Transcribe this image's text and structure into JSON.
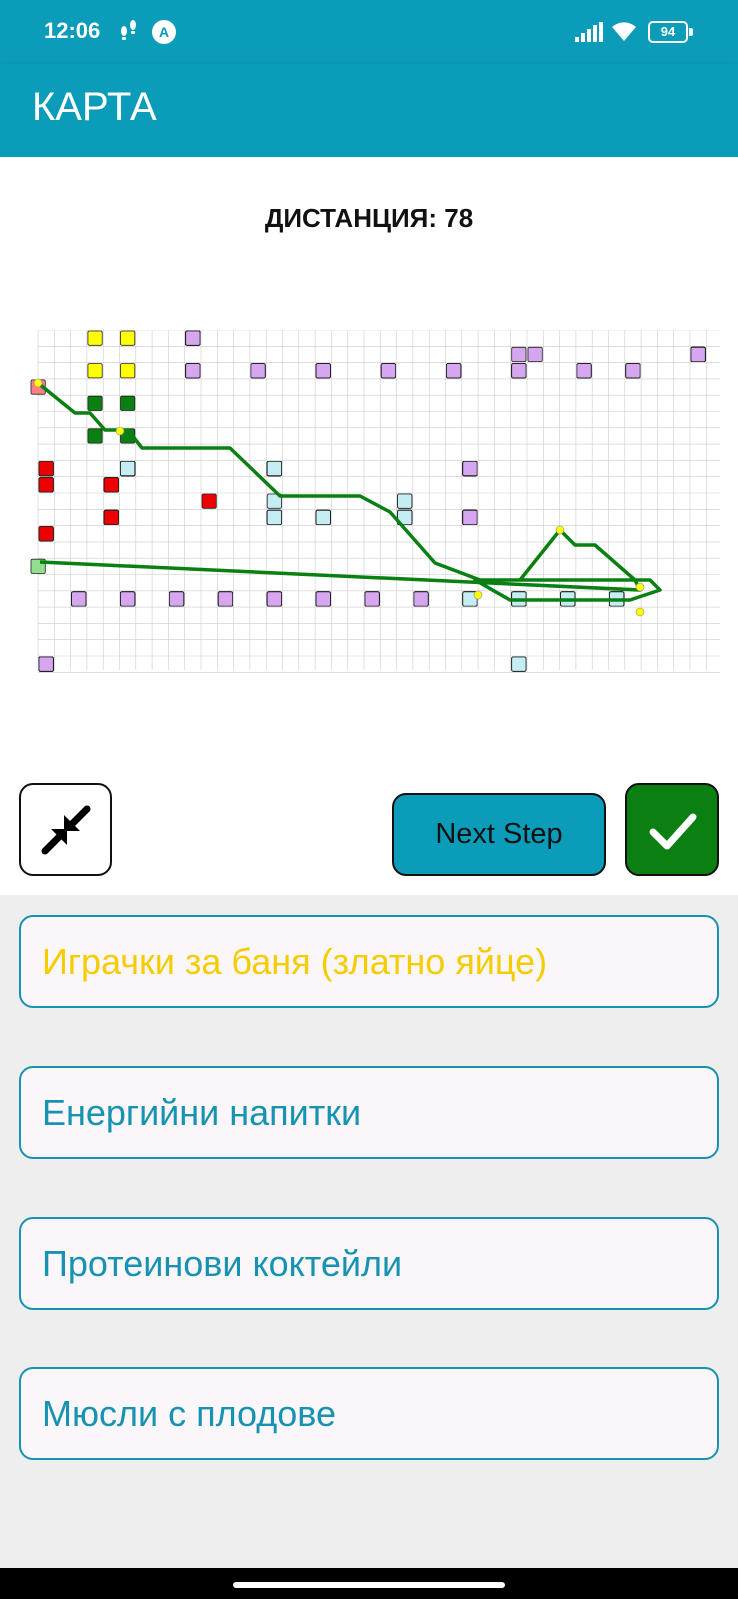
{
  "status": {
    "time": "12:06",
    "steps_icon": "footsteps-icon",
    "app_icon_letter": "A",
    "battery": "94",
    "icons": [
      "signal-icon",
      "wifi-icon",
      "battery-icon"
    ]
  },
  "appbar": {
    "title": "КАРТА"
  },
  "distance": {
    "text": "ДИСТАНЦИЯ: 78"
  },
  "map": {
    "legend_colors": {
      "shelf": "#d6a6f0",
      "visited_shelf": "#c4eef4",
      "red_shelf": "#ee0000",
      "yellow_marker": "#ffff00",
      "green_marker": "#0a7f12",
      "route": "#0a7f12",
      "stop_point": "#ffff00",
      "entrance": "#90e090"
    }
  },
  "buttons": {
    "zoom_icon": "collapse-arrows-icon",
    "next_label": "Next Step",
    "confirm_icon": "check-icon"
  },
  "items": [
    {
      "label": "Играчки за баня (златно яйце)",
      "color": "#f5cc00"
    },
    {
      "label": "Енергийни напитки",
      "color": "#1593b0"
    },
    {
      "label": "Протеинови коктейли",
      "color": "#1593b0"
    },
    {
      "label": "Мюсли с плодове",
      "color": "#1593b0"
    }
  ],
  "colors": {
    "primary": "#0a9cb8",
    "confirm": "#0a7f12",
    "item_text": "#1593b0",
    "highlight_text": "#f5cc00"
  }
}
